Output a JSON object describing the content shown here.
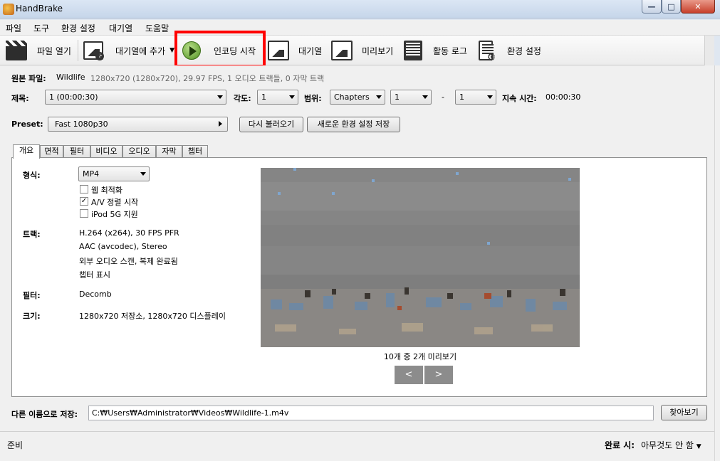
{
  "window": {
    "title": "HandBrake",
    "controls": {
      "minimize": "—",
      "maximize": "□",
      "close": "✕"
    }
  },
  "menu": [
    "파일",
    "도구",
    "환경 설정",
    "대기열",
    "도움말"
  ],
  "toolbar": {
    "open_file": "파일 열기",
    "add_to_queue": "대기열에 추가",
    "start_encode": "인코딩 시작",
    "queue": "대기열",
    "preview": "미리보기",
    "activity_log": "활동 로그",
    "preferences": "환경 설정",
    "icons": [
      "clapperboard-icon",
      "add-image-icon",
      "play-icon",
      "queue-icon",
      "preview-icon",
      "activity-log-icon",
      "settings-doc-icon"
    ]
  },
  "source": {
    "label": "원본 파일:",
    "name": "Wildlife",
    "info": "1280x720 (1280x720), 29.97 FPS, 1 오디오 트랙들, 0 자막 트랙"
  },
  "title_row": {
    "title_label": "제목:",
    "title_value": "1  (00:00:30)",
    "angle_label": "각도:",
    "angle_value": "1",
    "range_label": "범위:",
    "range_type": "Chapters",
    "range_start": "1",
    "range_dash": "-",
    "range_end": "1",
    "duration_label": "지속 시간:",
    "duration_value": "00:00:30"
  },
  "preset": {
    "label": "Preset:",
    "value": "Fast 1080p30",
    "reload": "다시 불러오기",
    "save_new": "새로운 환경 설정 저장"
  },
  "tabs": [
    "개요",
    "면적",
    "필터",
    "비디오",
    "오디오",
    "자막",
    "챕터"
  ],
  "summary": {
    "format_label": "형식:",
    "format_value": "MP4",
    "web_optimized": "웹 최적화",
    "av_align": "A/V 정렬 시작",
    "ipod": "iPod 5G 지원",
    "tracks_label": "트랙:",
    "tracks": [
      "H.264 (x264), 30 FPS PFR",
      "AAC (avcodec), Stereo",
      "외부 오디오 스캔, 복제 완료됨",
      "챕터 표시"
    ],
    "filters_label": "필터:",
    "filters_value": "Decomb",
    "size_label": "크기:",
    "size_value": "1280x720 저장소, 1280x720 디스플레이",
    "preview_caption": "10개 중 2개 미리보기",
    "prev": "<",
    "next": ">"
  },
  "checks": {
    "web_optimized": "",
    "av_align": "✓",
    "ipod": ""
  },
  "save_as": {
    "label": "다른 이름으로 저장:",
    "path": "C:₩Users₩Administrator₩Videos₩Wildlife-1.m4v",
    "browse": "찾아보기"
  },
  "status": {
    "text": "준비",
    "when_done_label": "완료 시:",
    "when_done_value": "아무것도 안 함"
  }
}
